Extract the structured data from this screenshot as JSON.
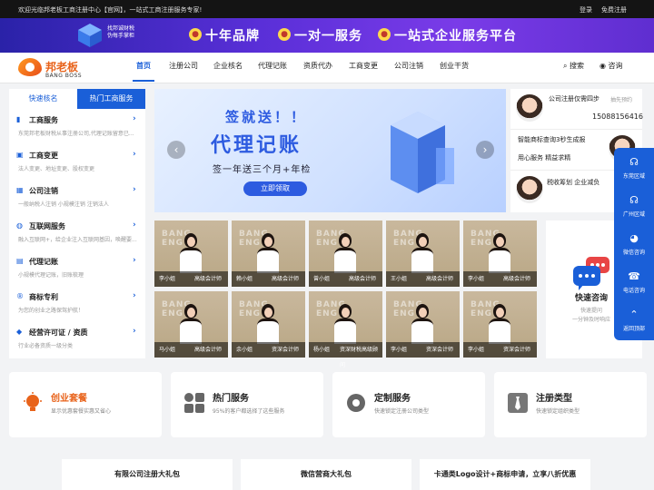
{
  "topbar": {
    "welcome": "欢迎光临邦老板工商注册中心【官网】，一站式工商注册服务专家!",
    "login": "登录",
    "register": "免费注册"
  },
  "banner": {
    "line1": "找邦诚财税",
    "line2": "伪每手掌柜",
    "slogan1": "十年品牌",
    "slogan2": "一对一服务",
    "slogan3": "一站式企业服务平台"
  },
  "logo": {
    "name": "邦老板",
    "en": "BANG BOSS"
  },
  "nav": {
    "items": [
      "首页",
      "注册公司",
      "企业核名",
      "代理记账",
      "资质代办",
      "工商变更",
      "公司注销",
      "创业干货"
    ],
    "search": "搜索",
    "consult": "咨询"
  },
  "left": {
    "tab1": "快速核名",
    "tab2": "热门工商服务",
    "menu": [
      {
        "title": "工商服务",
        "desc": "东莞邦老板财税从事注册公司,代理记账留意已..."
      },
      {
        "title": "工商变更",
        "desc": "法人变更、地址变更、股权变更"
      },
      {
        "title": "公司注销",
        "desc": "一般纳税人注销 小规模注销 注销法人"
      },
      {
        "title": "互联网服务",
        "desc": "融入互联网+，给企业注入互联网基因，唤醒要..."
      },
      {
        "title": "代理记账",
        "desc": "小规模代理记账，旧账梳理"
      },
      {
        "title": "商标专利",
        "desc": "为您的创业之路保驾护航！"
      },
      {
        "title": "经营许可证 / 资质",
        "desc": "行业必备资质一级分类"
      }
    ]
  },
  "slider": {
    "line1": "签就送！！",
    "line2": "代理记账",
    "line3": "签一年送三个月+年检",
    "button": "立即领取",
    "prev": "‹",
    "next": "›"
  },
  "news": [
    {
      "title": "公司注册仅需四步",
      "sub": "抽先预约",
      "phone": "15088156416"
    },
    {
      "title": "智能商标查询3秒生成报",
      "sub": "用心服务 精益求精"
    },
    {
      "title": "税收筹划 企业减负",
      "phone": "15088156416"
    }
  ],
  "staff": [
    {
      "name": "李小姐",
      "role": "高级会计师"
    },
    {
      "name": "赖小姐",
      "role": "高级会计师"
    },
    {
      "name": "曾小姐",
      "role": "高级会计师"
    },
    {
      "name": "王小姐",
      "role": "高级会计师"
    },
    {
      "name": "李小姐",
      "role": "高级会计师"
    },
    {
      "name": "马小姐",
      "role": "高级会计师"
    },
    {
      "name": "余小姐",
      "role": "资深会计师"
    },
    {
      "name": "杨小姐",
      "role": "资深财税高级顾问"
    },
    {
      "name": "李小姐",
      "role": "资深会计师"
    },
    {
      "name": "李小姐",
      "role": "资深会计师"
    }
  ],
  "wall_text": "BANG ENG",
  "consult": {
    "title": "快速咨询",
    "line1": "快速提问",
    "line2": "一分钟及时响应"
  },
  "side": [
    "东莞区域",
    "广州区域",
    "微信咨询",
    "电话咨询",
    "返回顶部"
  ],
  "cards": [
    {
      "title": "创业套餐",
      "desc": "显示优惠套餐实惠又省心",
      "color": "#e8631b"
    },
    {
      "title": "热门服务",
      "desc": "95%的客户都选择了这些服务",
      "color": "#222"
    },
    {
      "title": "定制服务",
      "desc": "快速锁定注册公司类型",
      "color": "#222"
    },
    {
      "title": "注册类型",
      "desc": "快速锁定组织类型",
      "color": "#222"
    }
  ],
  "bottom": [
    "有限公司注册大礼包",
    "微信营商大礼包",
    "卡通类Logo设计+商标申请，立享八折优惠"
  ],
  "colors": {
    "primary": "#1a5fd8",
    "accent": "#e8631b"
  }
}
